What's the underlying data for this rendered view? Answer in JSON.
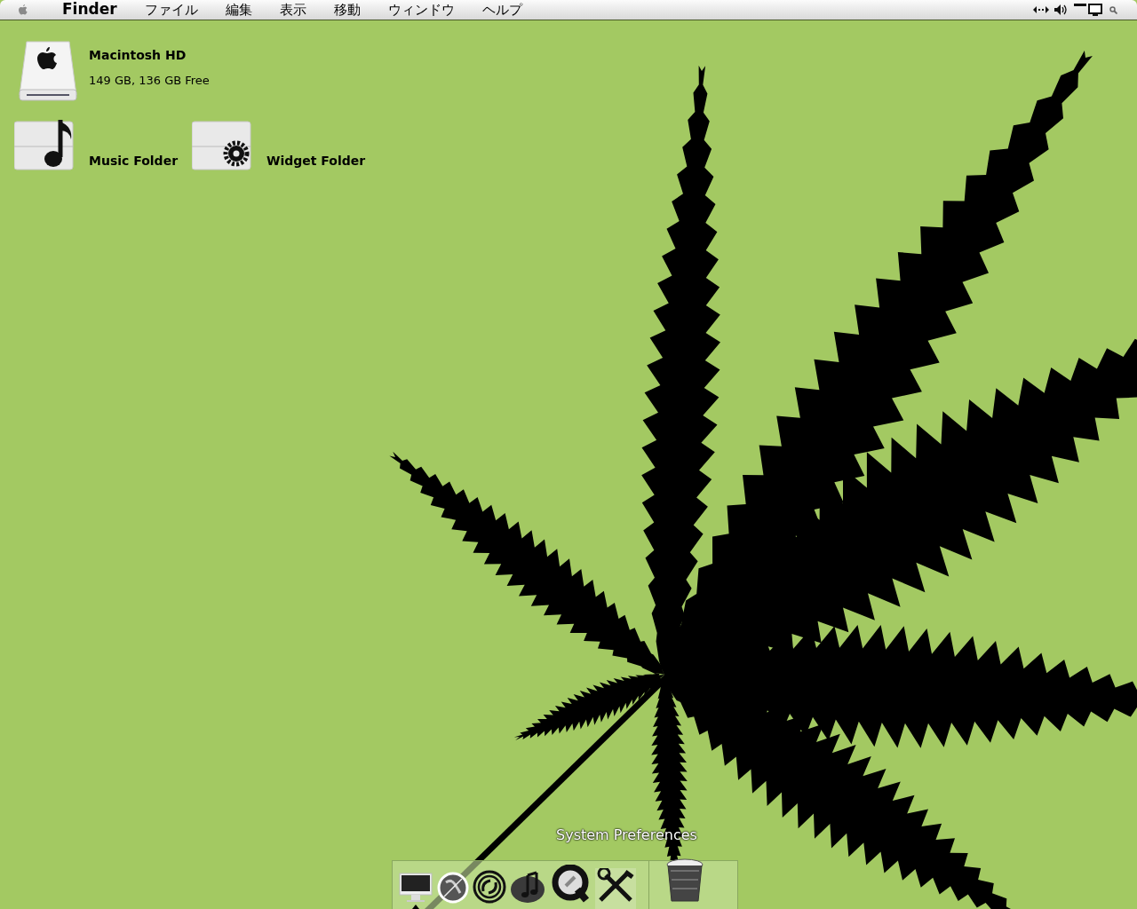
{
  "menu_bar": {
    "app_name": "Finder",
    "menus": [
      "ファイル",
      "編集",
      "表示",
      "移動",
      "ウィンドウ",
      "ヘルプ"
    ]
  },
  "desktop_icons": [
    {
      "kind": "drive",
      "name": "Macintosh HD",
      "detail": "149 GB, 136 GB Free"
    },
    {
      "kind": "music-folder",
      "name": "Music Folder"
    },
    {
      "kind": "widget-folder",
      "name": "Widget Folder"
    }
  ],
  "dock": {
    "tooltip": "System Preferences",
    "items": [
      {
        "kind": "monitor",
        "running": true,
        "hovered": false
      },
      {
        "kind": "globe",
        "running": false,
        "hovered": false
      },
      {
        "kind": "swirl",
        "running": false,
        "hovered": false
      },
      {
        "kind": "music",
        "running": false,
        "hovered": false
      },
      {
        "kind": "q",
        "running": false,
        "hovered": false
      },
      {
        "kind": "tools",
        "running": false,
        "hovered": true
      },
      {
        "kind": "trash",
        "running": false,
        "hovered": false
      }
    ]
  }
}
